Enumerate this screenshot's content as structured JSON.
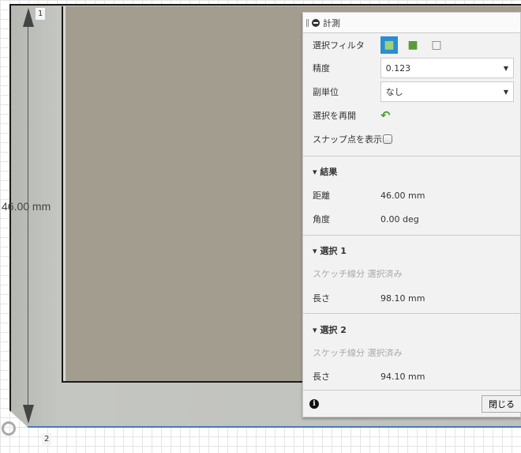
{
  "viewport": {
    "dimension_text": "46.00 mm",
    "point1": "1",
    "point2": "2"
  },
  "panel": {
    "title": "計測",
    "selection_filter_label": "選択フィルタ",
    "filter_icons": [
      "body-select-icon",
      "face-select-icon",
      "edge-select-icon"
    ],
    "precision_label": "精度",
    "precision_value": "0.123",
    "sub_unit_label": "副単位",
    "sub_unit_value": "なし",
    "restart_label": "選択を再開",
    "snap_label": "スナップ点を表示",
    "results": {
      "title": "結果",
      "distance_label": "距離",
      "distance_value": "46.00 mm",
      "angle_label": "角度",
      "angle_value": "0.00 deg"
    },
    "selection1": {
      "title": "選択 1",
      "status": "スケッチ線分 選択済み",
      "length_label": "長さ",
      "length_value": "98.10 mm"
    },
    "selection2": {
      "title": "選択 2",
      "status": "スケッチ線分 選択済み",
      "length_label": "長さ",
      "length_value": "94.10 mm"
    },
    "close_label": "閉じる",
    "accent": "#2a8fd0"
  }
}
